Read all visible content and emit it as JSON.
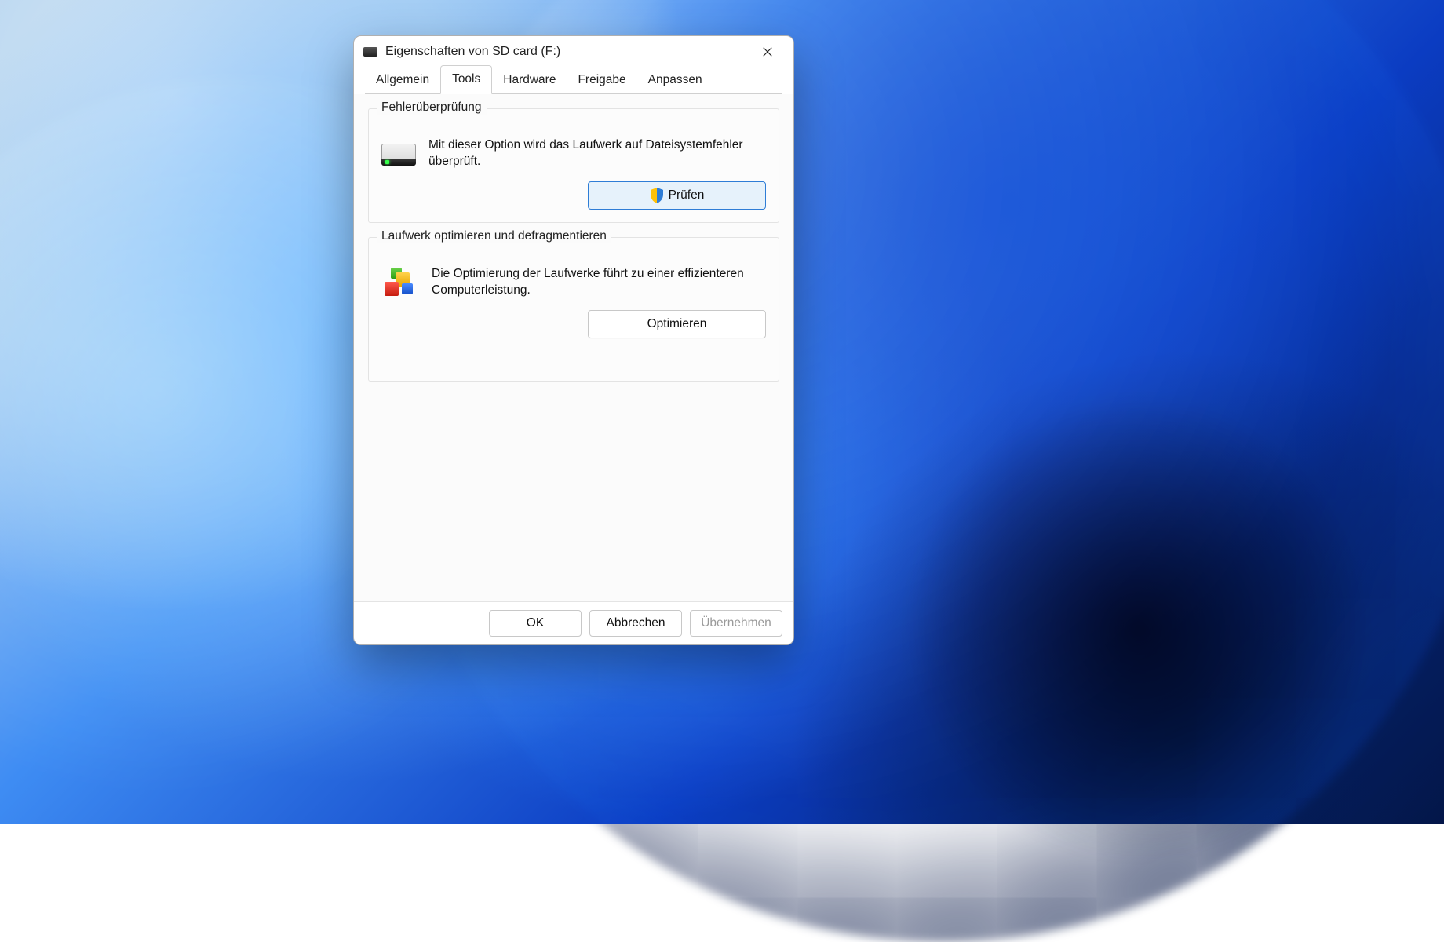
{
  "window": {
    "title": "Eigenschaften von SD card (F:)"
  },
  "tabs": {
    "general": "Allgemein",
    "tools": "Tools",
    "hardware": "Hardware",
    "share": "Freigabe",
    "customize": "Anpassen",
    "active": "tools"
  },
  "errorCheck": {
    "legend": "Fehlerüberprüfung",
    "description": "Mit dieser Option wird das Laufwerk auf Dateisystemfehler überprüft.",
    "button": "Prüfen"
  },
  "optimize": {
    "legend": "Laufwerk optimieren und defragmentieren",
    "description": "Die Optimierung der Laufwerke führt zu einer effizienteren Computerleistung.",
    "button": "Optimieren"
  },
  "footer": {
    "ok": "OK",
    "cancel": "Abbrechen",
    "apply": "Übernehmen"
  }
}
